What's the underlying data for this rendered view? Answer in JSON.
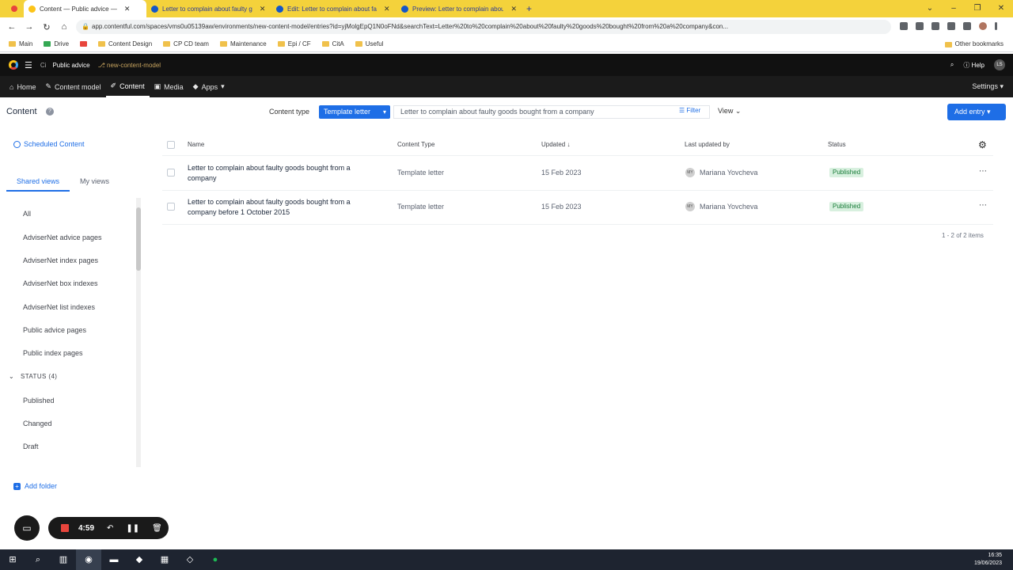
{
  "browser": {
    "tabs": [
      {
        "title": "Content — Public advice —"
      },
      {
        "title": "Letter to complain about faulty g"
      },
      {
        "title": "Edit: Letter to complain about fa"
      },
      {
        "title": "Preview: Letter to complain abou"
      }
    ],
    "url": "app.contentful.com/spaces/vms0u05139aw/environments/new-content-model/entries?id=yjMolgEpQ1N0oFNd&searchText=Letter%20to%20complain%20about%20faulty%20goods%20bought%20from%20a%20company&con...",
    "bookmarks": [
      "Main",
      "Drive",
      "Content Design",
      "CP CD team",
      "Maintenance",
      "Epi / CF",
      "CitA",
      "Useful"
    ],
    "other_bookmarks": "Other bookmarks"
  },
  "app": {
    "space_icon": "Ci",
    "space_name": "Public advice",
    "environment": "new-content-model",
    "help": "Help",
    "user_initials": "LS",
    "nav": {
      "home": "Home",
      "content_model": "Content model",
      "content": "Content",
      "media": "Media",
      "apps": "Apps",
      "settings": "Settings"
    }
  },
  "toolbar": {
    "title": "Content",
    "content_type_label": "Content type",
    "content_type_value": "Template letter",
    "search_value": "Letter to complain about faulty goods bought from a company",
    "filter": "Filter",
    "view": "View",
    "add_entry": "Add entry"
  },
  "sidebar": {
    "scheduled": "Scheduled Content",
    "tabs": [
      "Shared views",
      "My views"
    ],
    "views": [
      "All",
      "AdviserNet advice pages",
      "AdviserNet index pages",
      "AdviserNet box indexes",
      "AdviserNet list indexes",
      "Public advice pages",
      "Public index pages"
    ],
    "status_header": "STATUS (4)",
    "statuses": [
      "Published",
      "Changed",
      "Draft"
    ],
    "add_folder": "Add folder"
  },
  "table": {
    "headers": {
      "name": "Name",
      "content_type": "Content Type",
      "updated": "Updated",
      "last_updated_by": "Last updated by",
      "status": "Status"
    },
    "rows": [
      {
        "name": "Letter to complain about faulty goods bought from a company",
        "content_type": "Template letter",
        "updated": "15 Feb 2023",
        "user_initials": "MY",
        "user": "Mariana Yovcheva",
        "status": "Published"
      },
      {
        "name": "Letter to complain about faulty goods bought from a company before 1 October 2015",
        "content_type": "Template letter",
        "updated": "15 Feb 2023",
        "user_initials": "MY",
        "user": "Mariana Yovcheva",
        "status": "Published"
      }
    ],
    "count": "1 - 2 of 2 items"
  },
  "recorder": {
    "time": "4:59"
  },
  "taskbar": {
    "time": "16:35",
    "date": "19/06/2023"
  }
}
